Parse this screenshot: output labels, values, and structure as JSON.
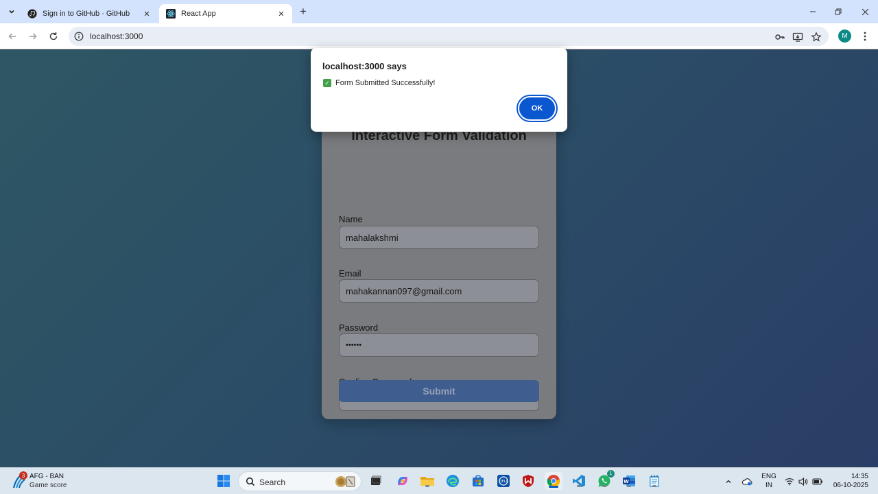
{
  "browser": {
    "tabs": [
      {
        "title": "Sign in to GitHub · GitHub",
        "icon": "github-icon",
        "active": false
      },
      {
        "title": "React App",
        "icon": "react-icon",
        "active": true
      }
    ],
    "url": "localhost:3000",
    "profile_initial": "M"
  },
  "dialog": {
    "title": "localhost:3000 says",
    "message": "Form Submitted Successfully!",
    "ok_label": "OK",
    "check_icon": "check-icon"
  },
  "form": {
    "title": "Interactive Form Validation",
    "fields": [
      {
        "label": "Name",
        "value": "mahalakshmi",
        "type": "text"
      },
      {
        "label": "Email",
        "value": "mahakannan097@gmail.com",
        "type": "email"
      },
      {
        "label": "Password",
        "value": "••••••",
        "type": "password"
      },
      {
        "label": "Confirm Password",
        "value": "••••••",
        "type": "password"
      }
    ],
    "submit_label": "Submit"
  },
  "taskbar": {
    "weather": {
      "badge": "3",
      "line1": "AFG - BAN",
      "line2": "Game score"
    },
    "search_label": "Search",
    "whatsapp_badge": "1",
    "language": {
      "line1": "ENG",
      "line2": "IN"
    },
    "clock": {
      "time": "14:35",
      "date": "06-10-2025"
    }
  },
  "colors": {
    "accent": "#0b57d0",
    "page_gradient_start": "#2e5763",
    "page_gradient_end": "#2a3d66",
    "card_bg": "#7a7b7e"
  }
}
